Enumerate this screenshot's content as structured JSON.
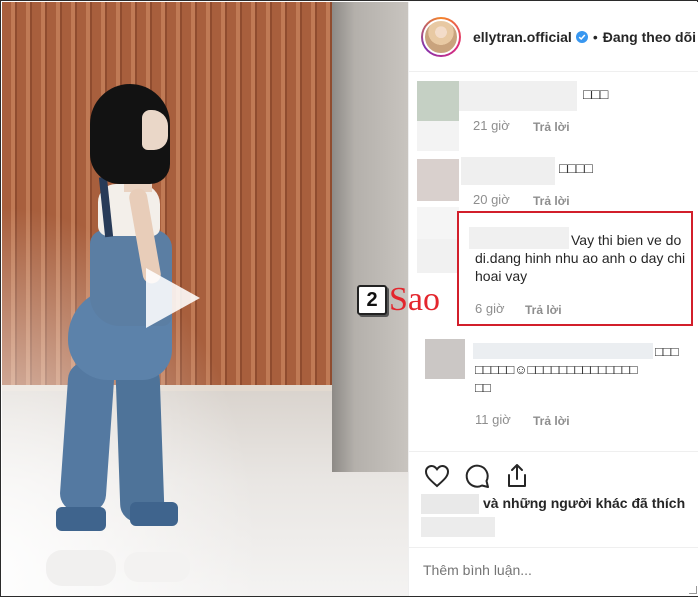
{
  "header": {
    "username": "ellytran.official",
    "separator": "•",
    "follow_status": "Đang theo dõi"
  },
  "watermark": {
    "badge": "2",
    "text": "Sao"
  },
  "comments": [
    {
      "text": "□□□",
      "time": "21 giờ",
      "reply": "Trả lời"
    },
    {
      "text": "□□□□",
      "time": "20 giờ",
      "reply": "Trả lời"
    },
    {
      "text": "Vay thi bien ve do di.dang hinh nhu ao anh o day chi hoai vay",
      "time": "6 giờ",
      "reply": "Trả lời",
      "highlighted": true
    },
    {
      "text_line1": "□□□",
      "text_line2": "□□□□□☺□□□□□□□□□□□□□□",
      "text_line3": "□□",
      "time": "11 giờ",
      "reply": "Trả lời"
    }
  ],
  "likes": {
    "suffix": "và những người khác đã thích"
  },
  "comment_box": {
    "placeholder": "Thêm bình luận..."
  },
  "icons": [
    "play-icon",
    "verified-icon",
    "heart-icon",
    "comment-icon",
    "share-icon"
  ],
  "colors": {
    "highlight": "#d21f2b",
    "verified": "#3897f0",
    "watermark_red": "#e3262d"
  }
}
